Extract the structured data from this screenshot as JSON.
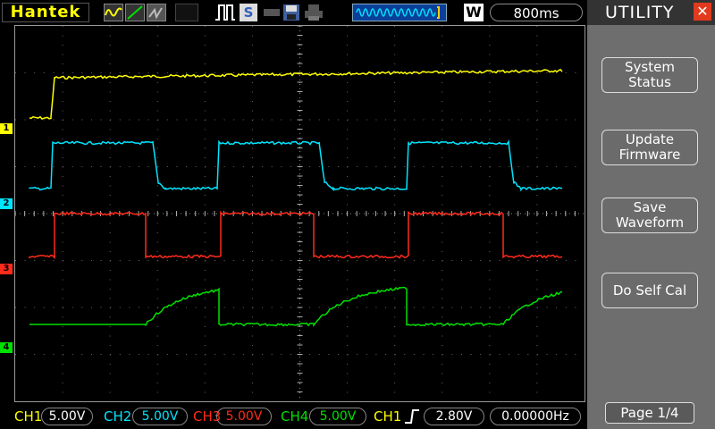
{
  "brand": "Hantek",
  "timebase_mode": "W",
  "timebase": "800ms",
  "panel": {
    "title": "UTILITY",
    "buttons": [
      "System\nStatus",
      "Update\nFirmware",
      "Save\nWaveform",
      "Do Self Cal"
    ],
    "page": "Page 1/4"
  },
  "channels": [
    {
      "label": "CH1",
      "scale": "5.00V",
      "color": "#ffff00",
      "marker": "1"
    },
    {
      "label": "CH2",
      "scale": "5.00V",
      "color": "#00e5ff",
      "marker": "2"
    },
    {
      "label": "CH3",
      "scale": "5.00V",
      "color": "#ff2a1a",
      "marker": "3"
    },
    {
      "label": "CH4",
      "scale": "5.00V",
      "color": "#00e000",
      "marker": "4"
    }
  ],
  "trigger": {
    "source": "CH1",
    "edge": "rising-edge-icon",
    "level": "2.80V",
    "frequency": "0.00000Hz"
  },
  "toolbar_icons": [
    "sine-wave-icon",
    "ramp-icon",
    "persist-icon",
    "pulse-icon",
    "single-icon",
    "save-icon",
    "print-icon",
    "trigger-status-icon"
  ]
}
